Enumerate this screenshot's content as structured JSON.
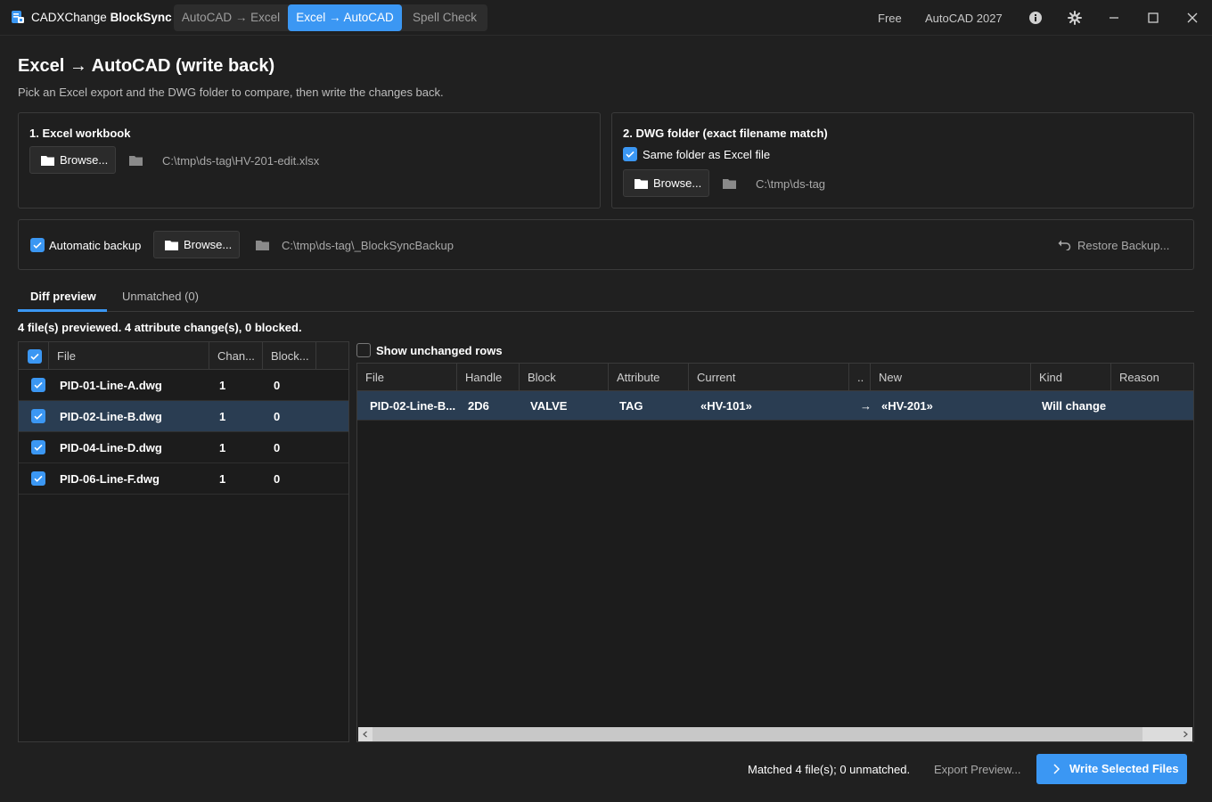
{
  "titlebar": {
    "app_name_plain": "CADXChange",
    "app_name_bold": "BlockSync",
    "tabs": [
      {
        "label": "AutoCAD → Excel",
        "active": false
      },
      {
        "label": "Excel → AutoCAD",
        "active": true
      },
      {
        "label": "Spell Check",
        "active": false
      }
    ],
    "plan": "Free",
    "product": "AutoCAD 2027",
    "icons": [
      "info-icon",
      "gear-icon",
      "minimize-icon",
      "maximize-icon",
      "close-icon"
    ]
  },
  "page": {
    "title": "Excel → AutoCAD (write back)",
    "subtitle": "Pick an Excel export and the DWG folder to compare, then write the changes back."
  },
  "excel_panel": {
    "heading": "1. Excel workbook",
    "browse_label": "Browse...",
    "path": "C:\\tmp\\ds-tag\\HV-201-edit.xlsx"
  },
  "dwg_panel": {
    "heading": "2. DWG folder (exact filename match)",
    "same_folder_label": "Same folder as Excel file",
    "same_folder_checked": true,
    "browse_label": "Browse...",
    "path": "C:\\tmp\\ds-tag"
  },
  "backup": {
    "auto_label": "Automatic backup",
    "auto_checked": true,
    "browse_label": "Browse...",
    "path": "C:\\tmp\\ds-tag\\_BlockSyncBackup",
    "restore_label": "Restore Backup..."
  },
  "subtabs": [
    {
      "label": "Diff preview",
      "active": true
    },
    {
      "label": "Unmatched (0)",
      "active": false
    }
  ],
  "summary": "4 file(s) previewed. 4 attribute change(s), 0 blocked.",
  "files_table": {
    "headers": [
      "File",
      "Chan...",
      "Block..."
    ],
    "rows": [
      {
        "file": "PID-01-Line-A.dwg",
        "changes": "1",
        "blocked": "0",
        "checked": true,
        "selected": false
      },
      {
        "file": "PID-02-Line-B.dwg",
        "changes": "1",
        "blocked": "0",
        "checked": true,
        "selected": true
      },
      {
        "file": "PID-04-Line-D.dwg",
        "changes": "1",
        "blocked": "0",
        "checked": true,
        "selected": false
      },
      {
        "file": "PID-06-Line-F.dwg",
        "changes": "1",
        "blocked": "0",
        "checked": true,
        "selected": false
      }
    ]
  },
  "show_unchanged_label": "Show unchanged rows",
  "show_unchanged_checked": false,
  "diff_table": {
    "headers": [
      "File",
      "Handle",
      "Block",
      "Attribute",
      "Current",
      "..",
      "New",
      "Kind",
      "Reason"
    ],
    "rows": [
      {
        "file": "PID-02-Line-B....",
        "handle": "2D6",
        "block": "VALVE",
        "attribute": "TAG",
        "current": "«HV-101»",
        "arrow": "→",
        "new": "«HV-201»",
        "kind": "Will change",
        "reason": ""
      }
    ]
  },
  "footer": {
    "status": "Matched 4 file(s); 0 unmatched.",
    "export_label": "Export Preview...",
    "write_label": "Write Selected Files"
  },
  "colors": {
    "accent": "#3b97f3",
    "background": "#202020",
    "selected_row": "#2a3d52"
  }
}
